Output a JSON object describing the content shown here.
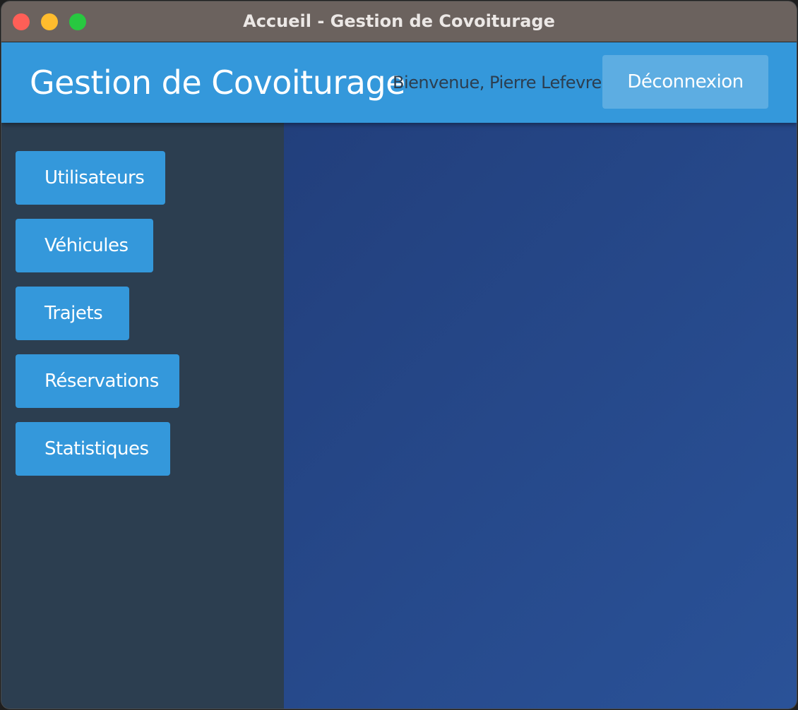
{
  "window": {
    "title": "Accueil - Gestion de Covoiturage",
    "controls": {
      "close_color": "#fe5f57",
      "minimize_color": "#febc2e",
      "maximize_color": "#28c840"
    }
  },
  "header": {
    "app_title": "Gestion de Covoiturage",
    "welcome_text": "Bienvenue, Pierre Lefevre",
    "logout_label": "Déconnexion",
    "background_color": "#3498db"
  },
  "sidebar": {
    "background_color": "#2c3e50",
    "items": [
      {
        "label": "Utilisateurs"
      },
      {
        "label": "Véhicules"
      },
      {
        "label": "Trajets"
      },
      {
        "label": "Réservations"
      },
      {
        "label": "Statistiques"
      }
    ]
  },
  "content": {
    "gradient_start": "#223f7c",
    "gradient_end": "#2a5298"
  }
}
